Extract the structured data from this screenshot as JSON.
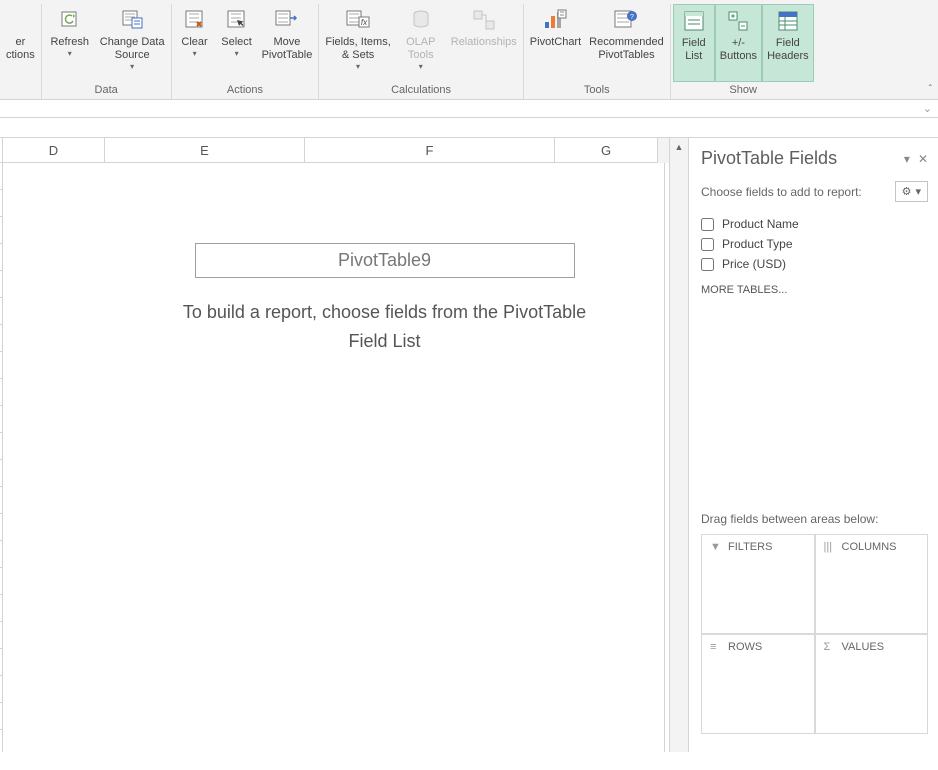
{
  "ribbon": {
    "partial_button": "er\nctions",
    "refresh": "Refresh",
    "change_source": "Change Data\nSource",
    "data_group": "Data",
    "clear": "Clear",
    "select": "Select",
    "move": "Move\nPivotTable",
    "actions_group": "Actions",
    "fields_items": "Fields, Items,\n& Sets",
    "olap": "OLAP\nTools",
    "relationships": "Relationships",
    "calc_group": "Calculations",
    "pivotchart": "PivotChart",
    "recommended": "Recommended\nPivotTables",
    "tools_group": "Tools",
    "field_list": "Field\nList",
    "buttons": "+/-\nButtons",
    "headers": "Field\nHeaders",
    "show_group": "Show"
  },
  "columns": {
    "d": "D",
    "e": "E",
    "f": "F",
    "g": "G"
  },
  "pivot": {
    "name": "PivotTable9",
    "msg": "To build a report, choose fields from the PivotTable Field List"
  },
  "pane": {
    "title": "PivotTable Fields",
    "choose": "Choose fields to add to report:",
    "field1": "Product Name",
    "field2": "Product Type",
    "field3": "Price (USD)",
    "more": "MORE TABLES...",
    "drag": "Drag fields between areas below:",
    "filters": "FILTERS",
    "columns_area": "COLUMNS",
    "rows": "ROWS",
    "values": "VALUES"
  }
}
